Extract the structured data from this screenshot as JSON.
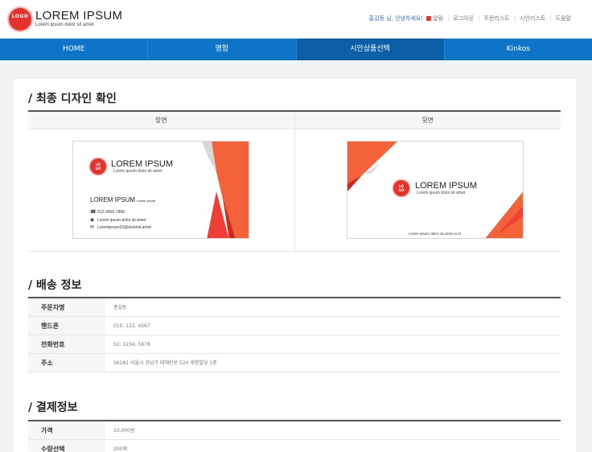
{
  "brand": {
    "logo": "LOGO",
    "title": "LOREM IPSUM",
    "subtitle": "Lorem ipsum dolor sit amet"
  },
  "util": {
    "greeting": "홍길동 님, 안녕하세요!",
    "notice": "알림",
    "links": [
      "로그아웃",
      "주문리스트",
      "시안리스트",
      "도움말"
    ]
  },
  "nav": {
    "items": [
      "HOME",
      "명함",
      "시안상품선택",
      "Kinkos"
    ],
    "active_index": 2
  },
  "design": {
    "title": "/ 최종 디자인 확인",
    "front_label": "앞면",
    "back_label": "뒷면",
    "front": {
      "title": "LOREM IPSUM",
      "subtitle": "Lorem ipsum dolor sit amet",
      "name": "LOREM IPSUM",
      "name_small": "Lorem ipsum",
      "phone": "012-3456-7890",
      "address": "Lorem ipsum dolor sit amet",
      "email": "Loremipsum23@dolorsit.amet"
    },
    "back": {
      "title": "LOREM IPSUM",
      "subtitle": "Lorem ipsum dolor sit amet",
      "footer": "Lorem ipsum dolor sit amet.co.kr"
    }
  },
  "shipping": {
    "title": "/ 배송 정보",
    "rows": [
      {
        "label": "주문자명",
        "value": "홍길동"
      },
      {
        "label": "핸드폰",
        "value": "010. 123. 4567"
      },
      {
        "label": "전화번호",
        "value": "02. 1234. 5678"
      },
      {
        "label": "주소",
        "value": "06181 서울시 강남구 테헤란로 524 세명빌딩 1층"
      }
    ]
  },
  "payment": {
    "title": "/ 결제정보",
    "rows": [
      {
        "label": "가격",
        "value": "10,000원"
      },
      {
        "label": "수량선택",
        "value": "200매"
      }
    ]
  },
  "colors": {
    "nav_blue": "#0e74c8",
    "nav_active": "#0a5fa6",
    "accent_red": "#e5322d",
    "orange": "#f4623a"
  }
}
